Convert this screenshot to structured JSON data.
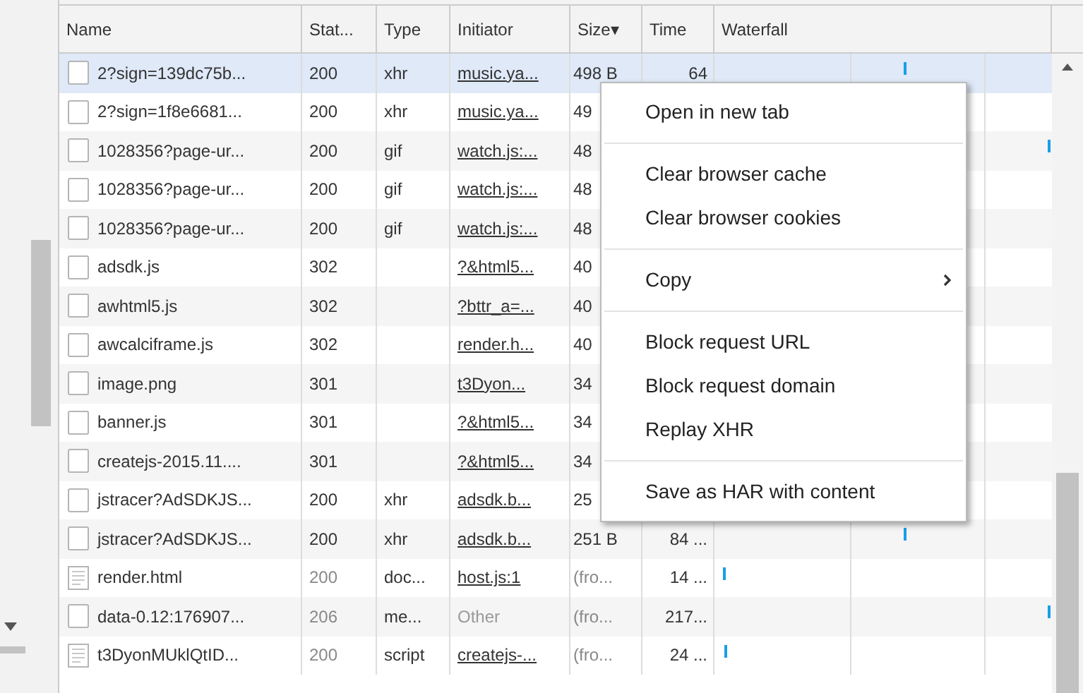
{
  "columns": [
    {
      "label": "Name"
    },
    {
      "label": "Stat..."
    },
    {
      "label": "Type"
    },
    {
      "label": "Initiator"
    },
    {
      "label": "Size▾"
    },
    {
      "label": "Time"
    },
    {
      "label": "Waterfall"
    }
  ],
  "rows": [
    {
      "name": "2?sign=139dc75b...",
      "status": "200",
      "type": "xhr",
      "initiator": "music.ya...",
      "initiator_link": true,
      "size": "498 B",
      "time": "64",
      "kind": "file",
      "cached": false,
      "selected": true
    },
    {
      "name": "2?sign=1f8e6681...",
      "status": "200",
      "type": "xhr",
      "initiator": "music.ya...",
      "initiator_link": true,
      "size": "49",
      "time": "",
      "kind": "file",
      "cached": false,
      "selected": false
    },
    {
      "name": "1028356?page-ur...",
      "status": "200",
      "type": "gif",
      "initiator": "watch.js:...",
      "initiator_link": true,
      "size": "48",
      "time": "",
      "kind": "file",
      "cached": false,
      "selected": false
    },
    {
      "name": "1028356?page-ur...",
      "status": "200",
      "type": "gif",
      "initiator": "watch.js:...",
      "initiator_link": true,
      "size": "48",
      "time": "",
      "kind": "file",
      "cached": false,
      "selected": false
    },
    {
      "name": "1028356?page-ur...",
      "status": "200",
      "type": "gif",
      "initiator": "watch.js:...",
      "initiator_link": true,
      "size": "48",
      "time": "",
      "kind": "file",
      "cached": false,
      "selected": false
    },
    {
      "name": "adsdk.js",
      "status": "302",
      "type": "",
      "initiator": "?&html5...",
      "initiator_link": true,
      "size": "40",
      "time": "",
      "kind": "file",
      "cached": false,
      "selected": false
    },
    {
      "name": "awhtml5.js",
      "status": "302",
      "type": "",
      "initiator": "?bttr_a=...",
      "initiator_link": true,
      "size": "40",
      "time": "",
      "kind": "file",
      "cached": false,
      "selected": false
    },
    {
      "name": "awcalciframe.js",
      "status": "302",
      "type": "",
      "initiator": "render.h...",
      "initiator_link": true,
      "size": "40",
      "time": "",
      "kind": "file",
      "cached": false,
      "selected": false
    },
    {
      "name": "image.png",
      "status": "301",
      "type": "",
      "initiator": "t3Dyon...",
      "initiator_link": true,
      "size": "34",
      "time": "",
      "kind": "file",
      "cached": false,
      "selected": false
    },
    {
      "name": "banner.js",
      "status": "301",
      "type": "",
      "initiator": "?&html5...",
      "initiator_link": true,
      "size": "34",
      "time": "",
      "kind": "file",
      "cached": false,
      "selected": false
    },
    {
      "name": "createjs-2015.11....",
      "status": "301",
      "type": "",
      "initiator": "?&html5...",
      "initiator_link": true,
      "size": "34",
      "time": "",
      "kind": "file",
      "cached": false,
      "selected": false
    },
    {
      "name": "jstracer?AdSDKJS...",
      "status": "200",
      "type": "xhr",
      "initiator": "adsdk.b...",
      "initiator_link": true,
      "size": "25",
      "time": "",
      "kind": "file",
      "cached": false,
      "selected": false
    },
    {
      "name": "jstracer?AdSDKJS...",
      "status": "200",
      "type": "xhr",
      "initiator": "adsdk.b...",
      "initiator_link": true,
      "size": "251 B",
      "time": "84 ...",
      "kind": "file",
      "cached": false,
      "selected": false
    },
    {
      "name": "render.html",
      "status": "200",
      "type": "doc...",
      "initiator": "host.js:1",
      "initiator_link": true,
      "size": "(fro...",
      "time": "14 ...",
      "kind": "document",
      "cached": true,
      "selected": false
    },
    {
      "name": "data-0.12:176907...",
      "status": "206",
      "type": "me...",
      "initiator": "Other",
      "initiator_link": false,
      "size": "(fro...",
      "time": "217...",
      "kind": "file",
      "cached": true,
      "selected": false
    },
    {
      "name": "t3DyonMUklQtID...",
      "status": "200",
      "type": "script",
      "initiator": "createjs-...",
      "initiator_link": true,
      "size": "(fro...",
      "time": "24 ...",
      "kind": "document",
      "cached": true,
      "selected": false
    }
  ],
  "context_menu": [
    {
      "kind": "item",
      "label": "Open in new tab"
    },
    {
      "kind": "separator"
    },
    {
      "kind": "item",
      "label": "Clear browser cache"
    },
    {
      "kind": "item",
      "label": "Clear browser cookies"
    },
    {
      "kind": "separator"
    },
    {
      "kind": "submenu",
      "label": "Copy"
    },
    {
      "kind": "separator"
    },
    {
      "kind": "item",
      "label": "Block request URL"
    },
    {
      "kind": "item",
      "label": "Block request domain"
    },
    {
      "kind": "item",
      "label": "Replay XHR"
    },
    {
      "kind": "separator"
    },
    {
      "kind": "item",
      "label": "Save as HAR with content"
    }
  ]
}
